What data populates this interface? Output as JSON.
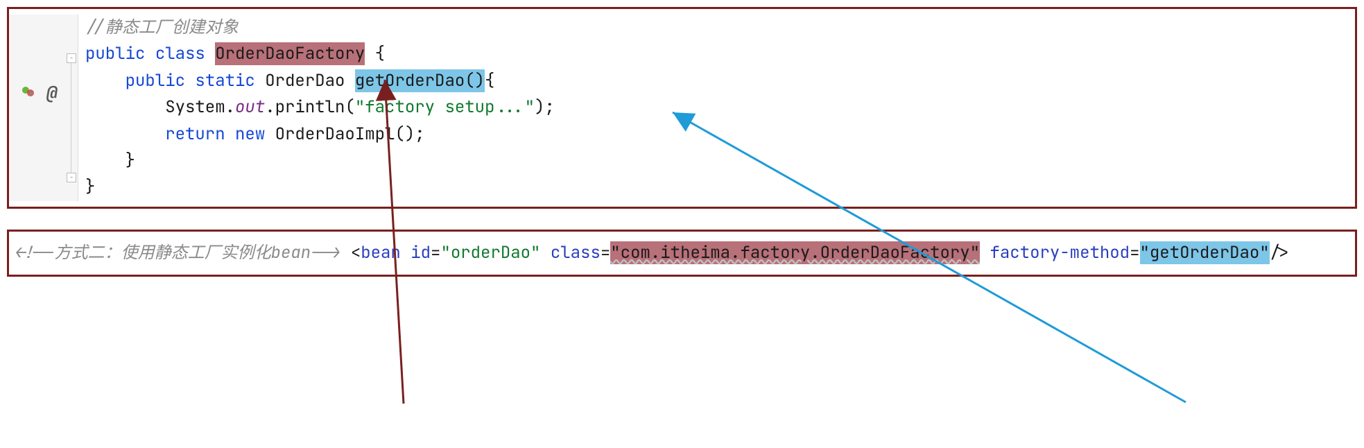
{
  "java": {
    "comment": "//静态工厂创建对象",
    "kw_public1": "public",
    "kw_class": "class",
    "class_name": "OrderDaoFactory",
    "brace_open": " {",
    "kw_public2": "public",
    "kw_static": "static",
    "return_type": "OrderDao",
    "method_name": "getOrderDao()",
    "brace_open2": "{",
    "sys": "System",
    "dot1": ".",
    "out": "out",
    "dot2": ".",
    "println": "println",
    "paren_open": "(",
    "str_literal": "\"factory setup...\"",
    "paren_close": ");",
    "kw_return": "return",
    "kw_new": "new",
    "impl": "OrderDaoImpl();",
    "brace_close1": "}",
    "brace_close2": "}"
  },
  "xml": {
    "comment": "<!--方式二：使用静态工厂实例化bean-->",
    "tag_open": "<",
    "bean": "bean",
    "attr_id": "id",
    "eq": "=",
    "val_id": "\"orderDao\"",
    "attr_class": "class",
    "val_class": "\"com.itheima.factory.OrderDaoFactory\"",
    "attr_fm": "factory-method",
    "val_fm": "\"getOrderDao\"",
    "tag_close": "/>"
  },
  "gutter": {
    "at": "@"
  }
}
